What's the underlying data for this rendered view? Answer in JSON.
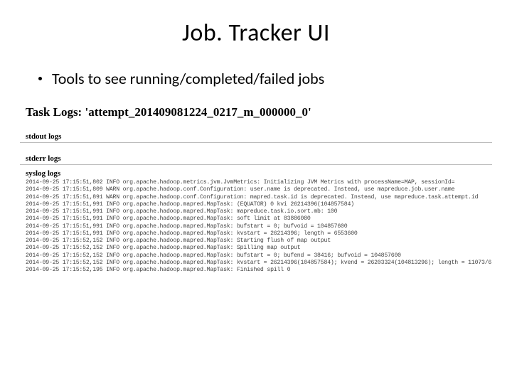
{
  "title": "Job. Tracker UI",
  "bullet": "Tools to see running/completed/failed jobs",
  "scr_title_prefix": "Task Logs: ",
  "scr_title_attempt": "'attempt_201409081224_0217_m_000000_0'",
  "sections": {
    "stdout": "stdout logs",
    "stderr": "stderr logs",
    "syslog": "syslog logs"
  },
  "syslog_lines": [
    "2014-09-25 17:15:51,802 INFO org.apache.hadoop.metrics.jvm.JvmMetrics: Initializing JVM Metrics with processName=MAP, sessionId=",
    "2014-09-25 17:15:51,809 WARN org.apache.hadoop.conf.Configuration: user.name is deprecated. Instead, use mapreduce.job.user.name",
    "2014-09-25 17:15:51,891 WARN org.apache.hadoop.conf.Configuration: mapred.task.id is deprecated. Instead, use mapreduce.task.attempt.id",
    "2014-09-25 17:15:51,991 INFO org.apache.hadoop.mapred.MapTask: (EQUATOR) 0 kvi 26214396(104857584)",
    "2014-09-25 17:15:51,991 INFO org.apache.hadoop.mapred.MapTask: mapreduce.task.io.sort.mb: 100",
    "2014-09-25 17:15:51,991 INFO org.apache.hadoop.mapred.MapTask: soft limit at 83886080",
    "2014-09-25 17:15:51,991 INFO org.apache.hadoop.mapred.MapTask: bufstart = 0; bufvoid = 104857600",
    "2014-09-25 17:15:51,991 INFO org.apache.hadoop.mapred.MapTask: kvstart = 26214396; length = 6553600",
    "2014-09-25 17:15:52,152 INFO org.apache.hadoop.mapred.MapTask: Starting flush of map output",
    "2014-09-25 17:15:52,152 INFO org.apache.hadoop.mapred.MapTask: Spilling map output",
    "2014-09-25 17:15:52,152 INFO org.apache.hadoop.mapred.MapTask: bufstart = 0; bufend = 38416; bufvoid = 104857600",
    "2014-09-25 17:15:52,152 INFO org.apache.hadoop.mapred.MapTask: kvstart = 26214396(104857584); kvend = 26203324(104813296); length = 11073/6",
    "2014-09-25 17:15:52,195 INFO org.apache.hadoop.mapred.MapTask: Finished spill 0"
  ]
}
